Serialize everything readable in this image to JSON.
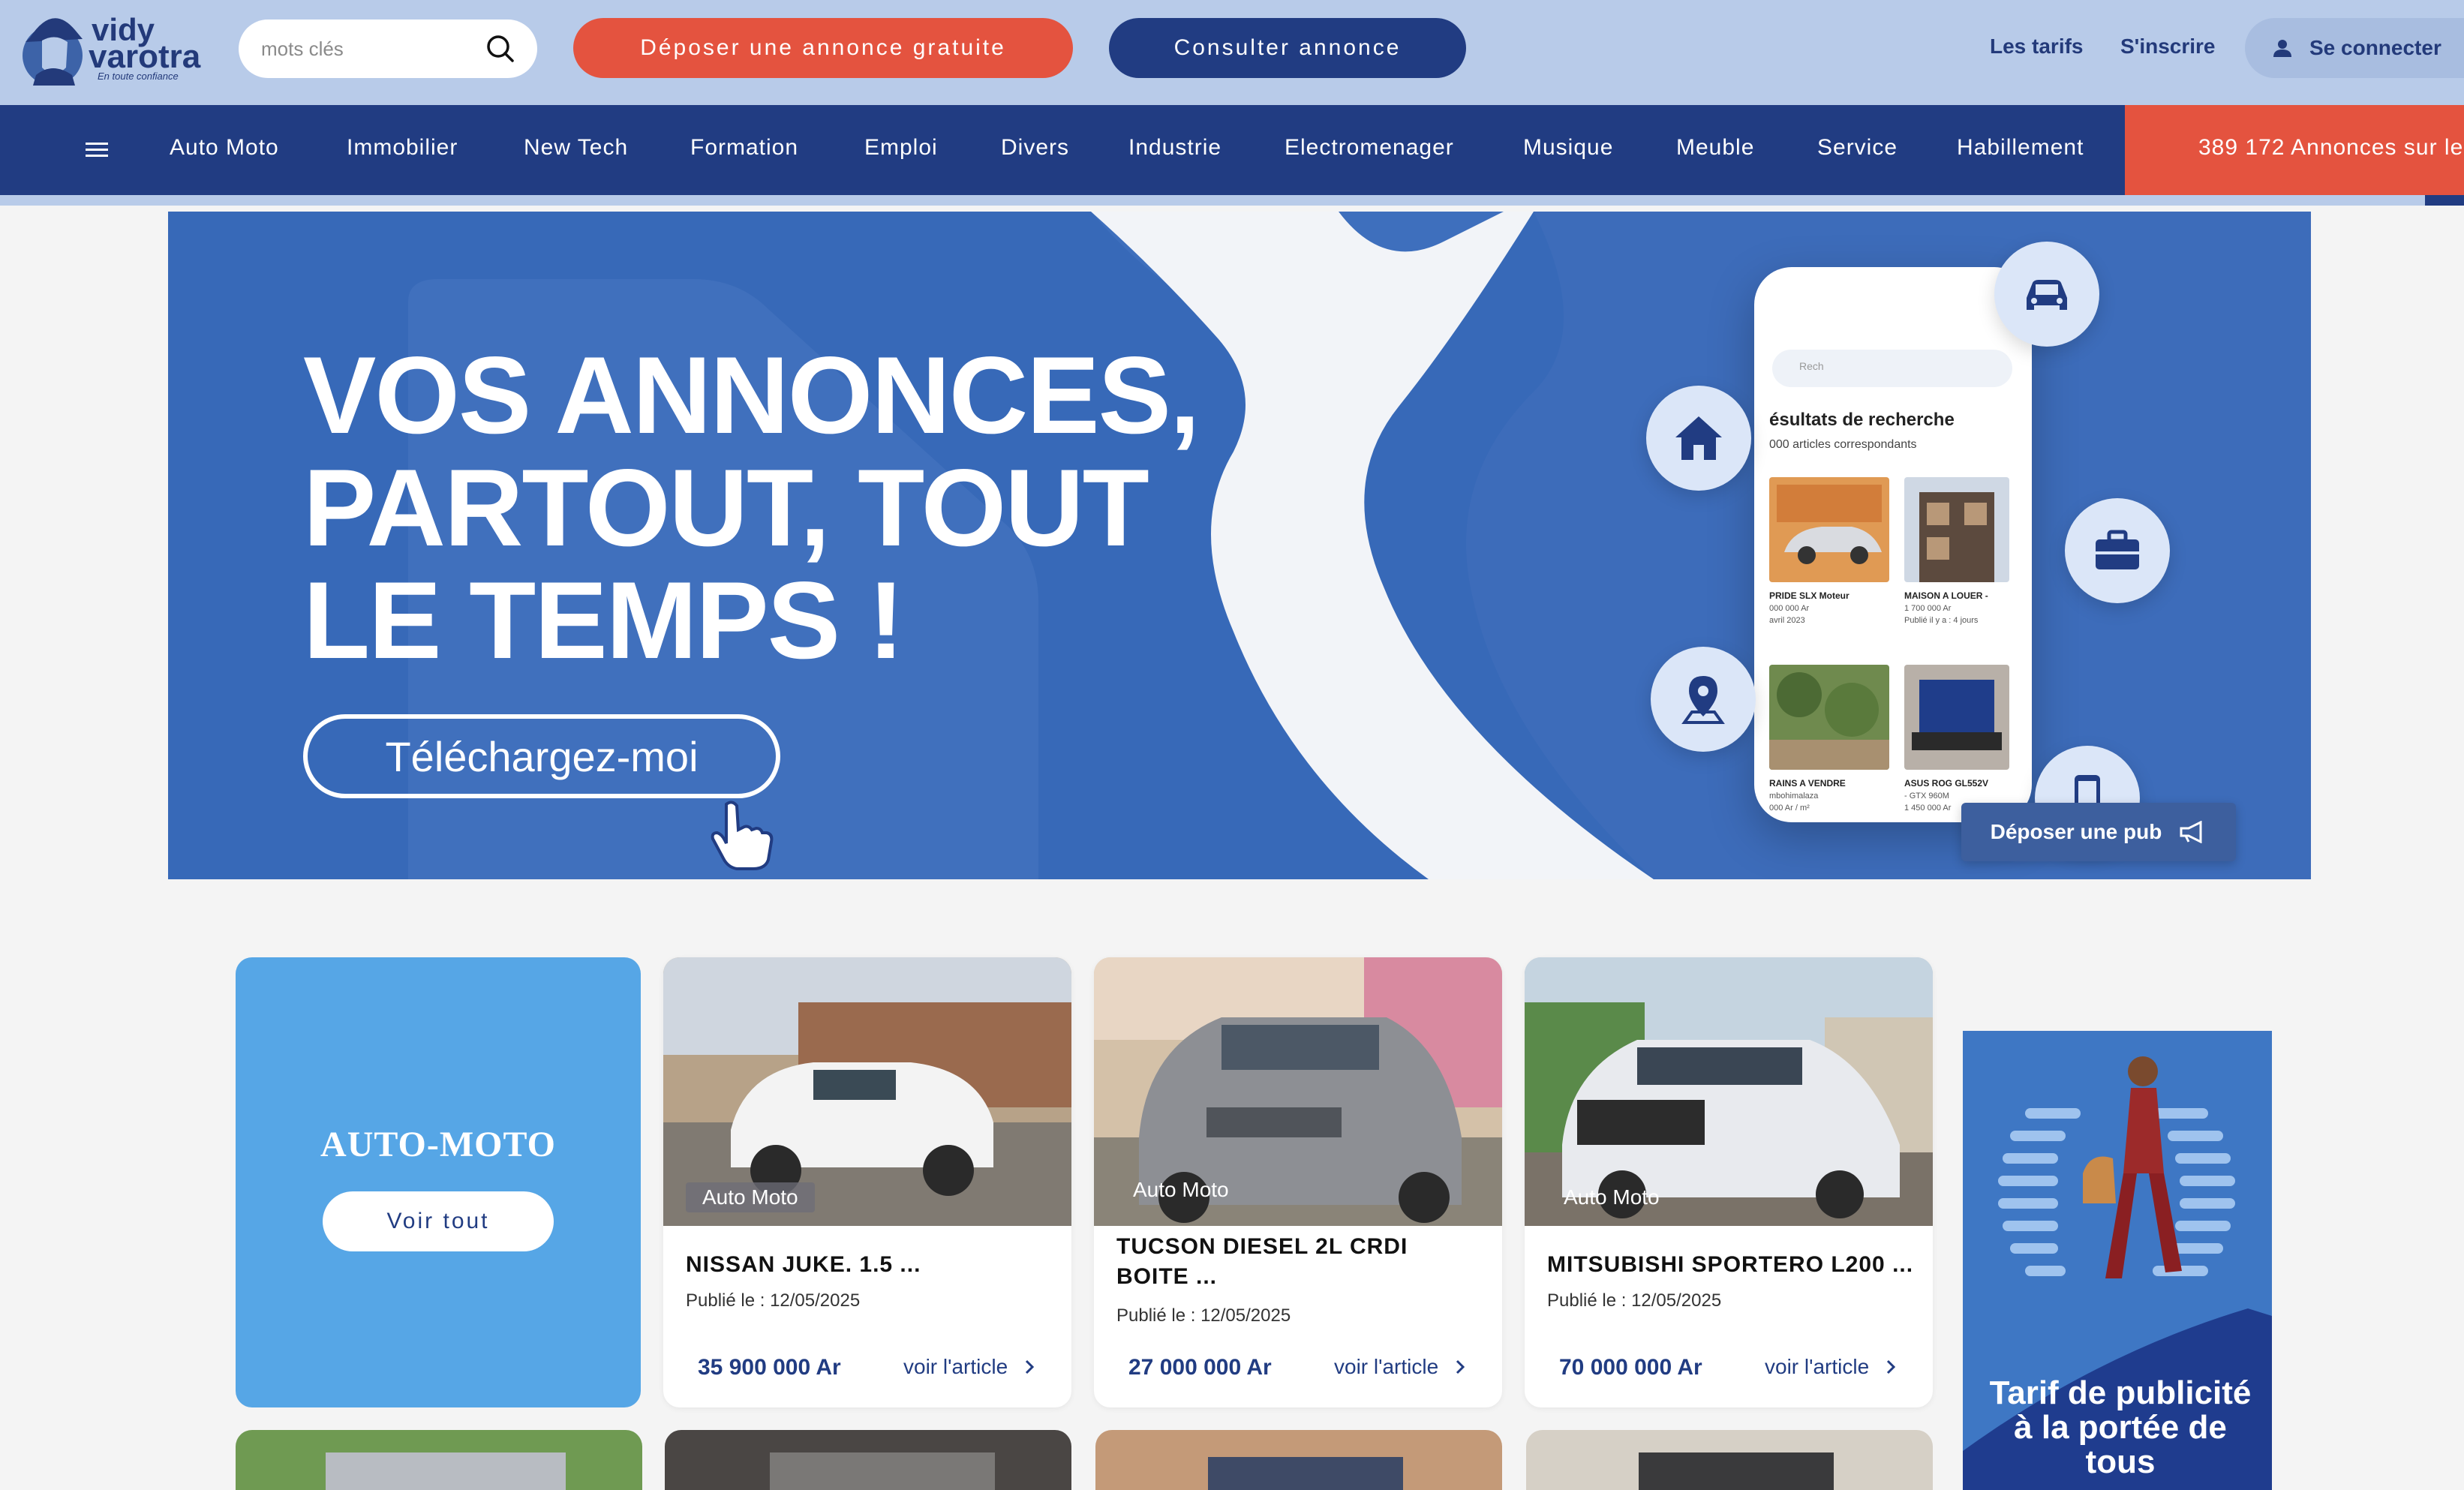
{
  "header": {
    "logo_line1": "vidy",
    "logo_line2": "varotra",
    "logo_tagline": "En toute confiance",
    "search_placeholder": "mots clés",
    "btn_depose": "Déposer une annonce gratuite",
    "btn_consult": "Consulter annonce",
    "link_tarifs": "Les tarifs",
    "link_inscrire": "S'inscrire",
    "btn_connect": "Se connecter"
  },
  "nav": {
    "items": [
      "Auto Moto",
      "Immobilier",
      "New Tech",
      "Formation",
      "Emploi",
      "Divers",
      "Industrie",
      "Electromenager",
      "Musique",
      "Meuble",
      "Service",
      "Habillement"
    ],
    "count_text": "389 172 Annonces sur le"
  },
  "banner": {
    "title_line1": "VOS ANNONCES,",
    "title_line2": "PARTOUT, TOUT",
    "title_line3": "LE TEMPS !",
    "cta": "Téléchargez-moi",
    "phone_search": "Rech",
    "phone_title": "ésultats de recherche",
    "phone_sub": "000 articles correspondants",
    "phone_items": [
      {
        "title": "PRIDE SLX Moteur",
        "sub1": "000 000 Ar",
        "sub2": "avril 2023"
      },
      {
        "title": "MAISON A LOUER -",
        "sub1": "1 700 000 Ar",
        "sub2": "Publié il y a : 4 jours"
      },
      {
        "title": "RAINS A VENDRE",
        "sub1": "mbohimalaza",
        "sub2": "000 Ar / m²"
      },
      {
        "title": "ASUS ROG GL552V",
        "sub1": "- GTX 960M",
        "sub2": "1 450 000 Ar"
      }
    ],
    "pub_button": "Déposer une pub"
  },
  "category": {
    "title": "AUTO-MOTO",
    "voir_tout": "Voir tout"
  },
  "listings": [
    {
      "tag": "Auto Moto",
      "title": "NISSAN JUKE. 1.5 ...",
      "date": "Publié le : 12/05/2025",
      "price": "35 900 000 Ar",
      "link": "voir l'article"
    },
    {
      "tag": "Auto Moto",
      "title": "TUCSON DIESEL 2L CRDI BOITE ...",
      "date": "Publié le : 12/05/2025",
      "price": "27 000 000 Ar",
      "link": "voir l'article"
    },
    {
      "tag": "Auto Moto",
      "title": "MITSUBISHI SPORTERO L200 ...",
      "date": "Publié le : 12/05/2025",
      "price": "70 000 000 Ar",
      "link": "voir l'article"
    }
  ],
  "ad": {
    "text": "Tarif de publicité à la portée de tous"
  },
  "colors": {
    "header_bg": "#b8cbe9",
    "nav_bg": "#213c82",
    "accent_red": "#e4533f",
    "category_blue": "#56a6e6"
  }
}
